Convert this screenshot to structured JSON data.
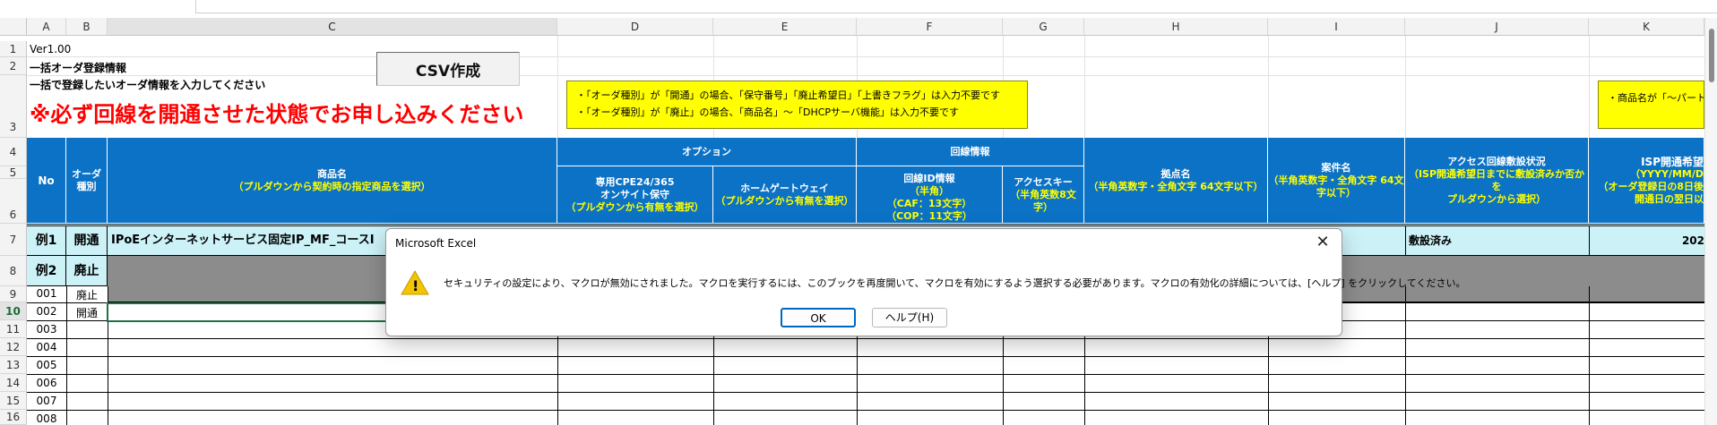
{
  "columns": [
    "A",
    "B",
    "C",
    "D",
    "E",
    "F",
    "G",
    "H",
    "I",
    "J",
    "K"
  ],
  "rows": [
    "1",
    "2",
    "3",
    "4",
    "5",
    "6",
    "7",
    "8",
    "9",
    "10",
    "11",
    "12",
    "13",
    "14",
    "15",
    "16"
  ],
  "top_text": {
    "version": "Ver1.00",
    "title": "一括オーダ登録情報",
    "instruction": "一括で登録したいオーダ情報を入力してください",
    "warning": "※必ず回線を開通させた状態でお申し込みください",
    "csv_button": "CSV作成"
  },
  "notes": {
    "note1_line1": "・「オーダ種別」が「開通」の場合、「保守番号」「廃止希望日」「上書きフラグ」は入力不要です",
    "note1_line2": "・「オーダ種別」が「廃止」の場合、「商品名」～「DHCPサーバ機能」は入力不要です",
    "note2": "・商品名が「～パートナ"
  },
  "header": {
    "no": "No",
    "order_type_1": "オーダ",
    "order_type_2": "種別",
    "product": "商品名",
    "product_sub": "（プルダウンから契約時の指定商品を選択）",
    "option": "オプション",
    "cpe_1": "専用CPE24/365",
    "cpe_2": "オンサイト保守",
    "cpe_3": "（プルダウンから有無を選択）",
    "hgw": "ホームゲートウェイ",
    "hgw_sub": "（プルダウンから有無を選択）",
    "line_info": "回線情報",
    "line_id": "回線ID情報",
    "line_id_2": "（半角）",
    "line_id_3": "（CAF：13文字）",
    "line_id_4": "（COP：11文字）",
    "access_key": "アクセスキー",
    "access_key_2": "（半角英数8文",
    "access_key_3": "字）",
    "site": "拠点名",
    "site_sub": "（半角英数字・全角文字 64文字以下）",
    "case": "案件名",
    "case_sub1": "（半角英数字・全角文字 64文",
    "case_sub2": "字以下）",
    "access_status": "アクセス回線敷設状況",
    "access_status_sub1": "（ISP開通希望日までに敷設済みか否かを",
    "access_status_sub2": "プルダウンから選択）",
    "isp": "ISP開通希望",
    "isp_sub1": "（YYYY/MM/D",
    "isp_sub2": "（オーダ登録日の8日後",
    "isp_sub3": "開通日の翌日以"
  },
  "examples": {
    "ex1_no": "例1",
    "ex1_type": "開通",
    "ex1_product": "IPoEインターネットサービス固定IP_MF_コースI",
    "ex1_status": "敷設済み",
    "ex1_isp": "202",
    "ex2_no": "例2",
    "ex2_type": "廃止"
  },
  "data_rows": [
    {
      "no": "001",
      "type": "廃止"
    },
    {
      "no": "002",
      "type": "開通"
    },
    {
      "no": "003",
      "type": ""
    },
    {
      "no": "004",
      "type": ""
    },
    {
      "no": "005",
      "type": ""
    },
    {
      "no": "006",
      "type": ""
    },
    {
      "no": "007",
      "type": ""
    },
    {
      "no": "008",
      "type": ""
    }
  ],
  "dialog": {
    "title": "Microsoft Excel",
    "message": "セキュリティの設定により、マクロが無効にされました。マクロを実行するには、このブックを再度開いて、マクロを有効にするよう選択する必要があります。マクロの有効化の詳細については、[ヘルプ] をクリックしてください。",
    "ok_label": "OK",
    "help_label": "ヘルプ(H)",
    "close_glyph": "✕",
    "warning_glyph": "!"
  },
  "colors": {
    "header_blue": "#0b72c6",
    "header_yellow_text": "#ffff00",
    "note_bg": "#ffff00",
    "warning_red": "#ff0000",
    "example1_bg": "#ccf2f8",
    "example2_bg": "#8c8c8c"
  }
}
